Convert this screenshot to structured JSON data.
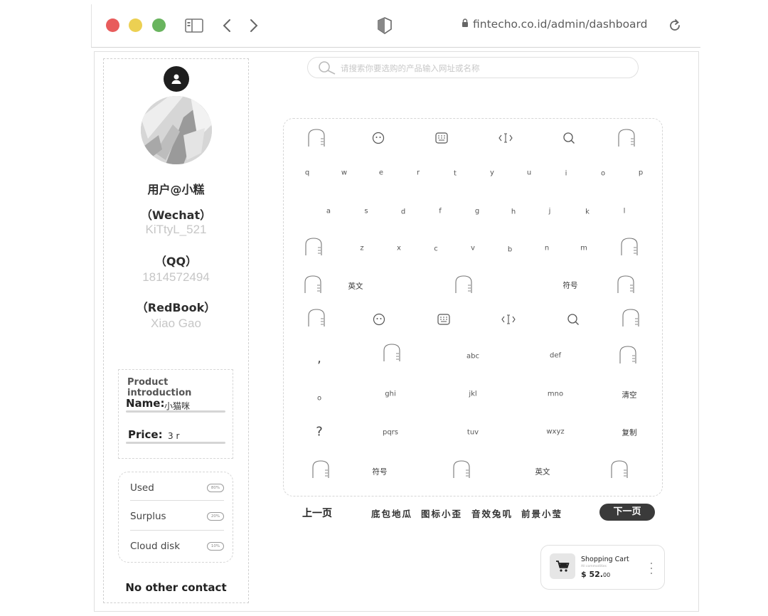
{
  "browser": {
    "url": "fintecho.co.id/admin/dashboard"
  },
  "profile": {
    "handle": "用户@小糕",
    "contacts": [
      {
        "label": "（Wechat）",
        "value": "KiTtyL_521"
      },
      {
        "label": "（QQ）",
        "value": "1814572494"
      },
      {
        "label": "（RedBook）",
        "value": "Xiao Gao"
      }
    ]
  },
  "product": {
    "title": "Product introduction",
    "name_label": "Name:",
    "name_value": "小猫咪",
    "price_label": "Price:",
    "price_value": "3 r"
  },
  "usage": [
    {
      "label": "Used",
      "badge": "80%"
    },
    {
      "label": "Surplus",
      "badge": "20%"
    },
    {
      "label": "Cloud disk",
      "badge": "10%"
    }
  ],
  "no_other_contact": "No other contact",
  "search": {
    "placeholder": "请搜索你要选购的产品输入网址或名称"
  },
  "keyboard": {
    "row1": [
      "q",
      "w",
      "e",
      "r",
      "t",
      "y",
      "u",
      "i",
      "o",
      "p"
    ],
    "row2": [
      "a",
      "s",
      "d",
      "f",
      "g",
      "h",
      "j",
      "k",
      "l"
    ],
    "row3": [
      "z",
      "x",
      "c",
      "v",
      "b",
      "n",
      "m"
    ],
    "row4": {
      "lang": "英文",
      "symbol": "符号"
    },
    "t9": {
      "comma": ",",
      "abc": "abc",
      "def": "def",
      "o": "o",
      "ghi": "ghi",
      "jkl": "jkl",
      "mno": "mno",
      "clear": "清空",
      "question": "?",
      "pqrs": "pqrs",
      "tuv": "tuv",
      "wxyz": "wxyz",
      "copy": "复制",
      "symbol": "符号",
      "lang": "英文"
    }
  },
  "pager": {
    "prev": "上一页",
    "tags": [
      "底包地瓜",
      "图标小歪",
      "音效兔叽",
      "前景小莹"
    ],
    "next": "下一页"
  },
  "cart": {
    "title": "Shopping Cart",
    "subtitle": "All commodities",
    "price_main": "$ 52.",
    "price_cents": "00"
  }
}
